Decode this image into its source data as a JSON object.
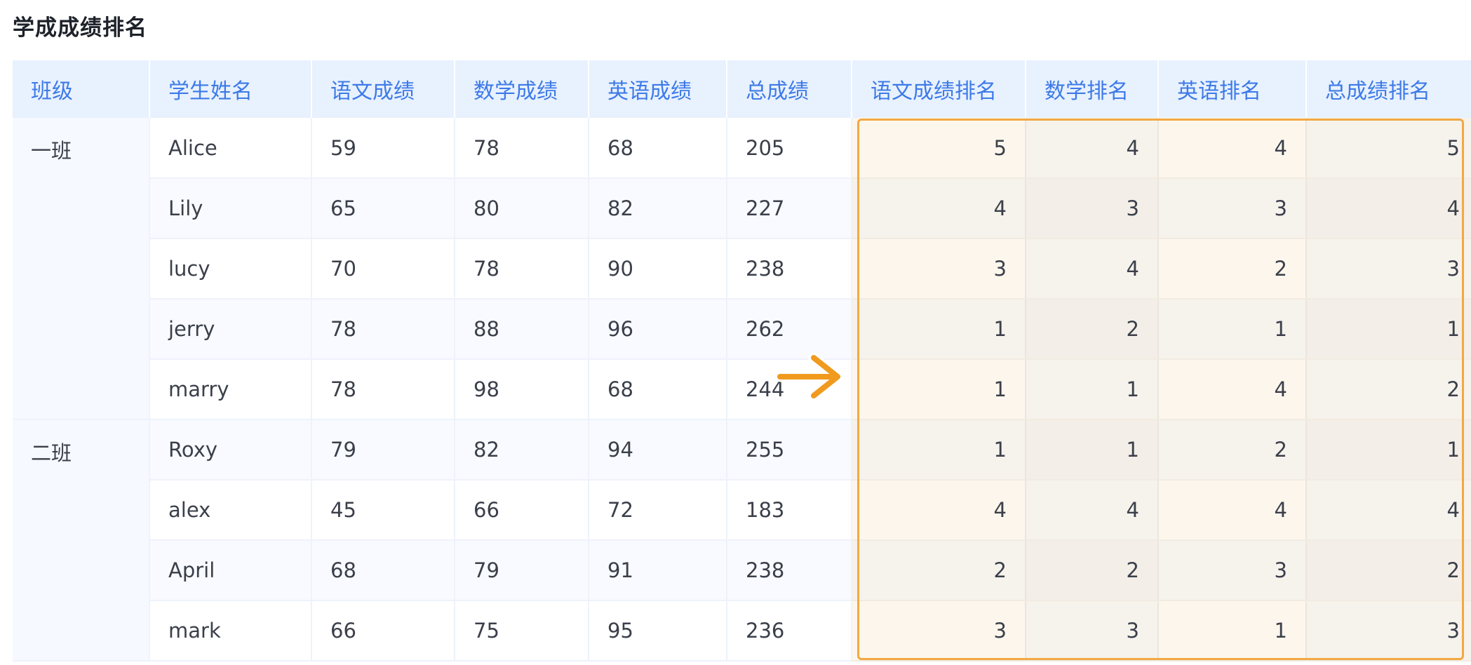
{
  "page": {
    "title": "学成成绩排名"
  },
  "table": {
    "headers": [
      "班级",
      "学生姓名",
      "语文成绩",
      "数学成绩",
      "英语成绩",
      "总成绩",
      "语文成绩排名",
      "数学排名",
      "英语排名",
      "总成绩排名"
    ],
    "groups": [
      {
        "class_name": "一班",
        "rows": [
          {
            "name": "Alice",
            "chinese": "59",
            "math": "78",
            "english": "68",
            "total": "205",
            "chinese_rank": "5",
            "math_rank": "4",
            "english_rank": "4",
            "total_rank": "5"
          },
          {
            "name": "Lily",
            "chinese": "65",
            "math": "80",
            "english": "82",
            "total": "227",
            "chinese_rank": "4",
            "math_rank": "3",
            "english_rank": "3",
            "total_rank": "4"
          },
          {
            "name": "lucy",
            "chinese": "70",
            "math": "78",
            "english": "90",
            "total": "238",
            "chinese_rank": "3",
            "math_rank": "4",
            "english_rank": "2",
            "total_rank": "3"
          },
          {
            "name": "jerry",
            "chinese": "78",
            "math": "88",
            "english": "96",
            "total": "262",
            "chinese_rank": "1",
            "math_rank": "2",
            "english_rank": "1",
            "total_rank": "1"
          },
          {
            "name": "marry",
            "chinese": "78",
            "math": "98",
            "english": "68",
            "total": "244",
            "chinese_rank": "1",
            "math_rank": "1",
            "english_rank": "4",
            "total_rank": "2"
          }
        ]
      },
      {
        "class_name": "二班",
        "rows": [
          {
            "name": "Roxy",
            "chinese": "79",
            "math": "82",
            "english": "94",
            "total": "255",
            "chinese_rank": "1",
            "math_rank": "1",
            "english_rank": "2",
            "total_rank": "1"
          },
          {
            "name": "alex",
            "chinese": "45",
            "math": "66",
            "english": "72",
            "total": "183",
            "chinese_rank": "4",
            "math_rank": "4",
            "english_rank": "4",
            "total_rank": "4"
          },
          {
            "name": "April",
            "chinese": "68",
            "math": "79",
            "english": "91",
            "total": "238",
            "chinese_rank": "2",
            "math_rank": "2",
            "english_rank": "3",
            "total_rank": "2"
          },
          {
            "name": "mark",
            "chinese": "66",
            "math": "75",
            "english": "95",
            "total": "236",
            "chinese_rank": "3",
            "math_rank": "3",
            "english_rank": "1",
            "total_rank": "3"
          }
        ]
      }
    ]
  },
  "colors": {
    "header_bg": "#e8f1fe",
    "header_text": "#3d7ae8",
    "highlight_border": "#f2a943",
    "arrow": "#f09a1e"
  },
  "icons": {
    "annotation_arrow": "arrow-right-icon"
  }
}
